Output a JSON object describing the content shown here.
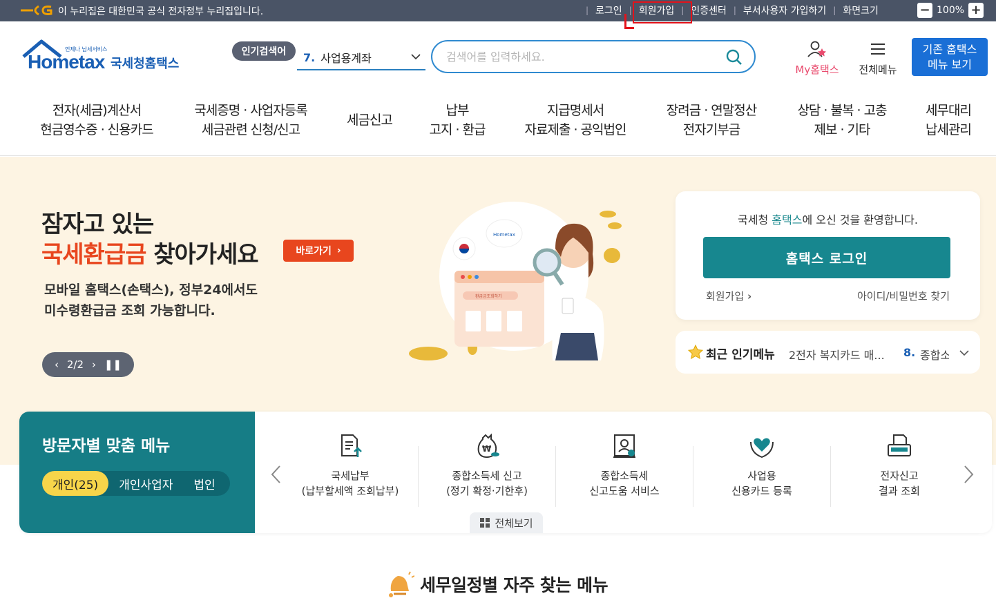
{
  "govbar": {
    "notice": "이 누리집은 대한민국 공식 전자정부 누리집입니다.",
    "links": [
      "로그인",
      "회원가입",
      "인증센터",
      "부서사용자 가입하기",
      "화면크기"
    ],
    "zoom": "100%",
    "zoom_minus": "−",
    "zoom_plus": "+"
  },
  "header": {
    "logo_brand": "Hometax",
    "logo_sub": "언제나 납세서비스",
    "logo_ko": "국세청홈택스",
    "popular_label": "인기검색어",
    "popular_num": "7.",
    "popular_term": "사업용계좌",
    "search_placeholder": "검색어를 입력하세요.",
    "my_label": "My홈택스",
    "all_menu_label": "전체메뉴",
    "old_menu_line1": "기존 홈택스",
    "old_menu_line2": "메뉴 보기"
  },
  "nav": [
    {
      "l1": "전자(세금)계산서",
      "l2": "현금영수증 · 신용카드"
    },
    {
      "l1": "국세증명 · 사업자등록",
      "l2": "세금관련 신청/신고"
    },
    {
      "l1": "세금신고",
      "l2": ""
    },
    {
      "l1": "납부",
      "l2": "고지 · 환급"
    },
    {
      "l1": "지급명세서",
      "l2": "자료제출 · 공익법인"
    },
    {
      "l1": "장려금 · 연말정산",
      "l2": "전자기부금"
    },
    {
      "l1": "상담 · 불복 · 고충",
      "l2": "제보 · 기타"
    },
    {
      "l1": "세무대리",
      "l2": "납세관리"
    }
  ],
  "hero": {
    "title1": "잠자고 있는",
    "title2_highlight": "국세환급금",
    "title2_rest": " 찾아가세요",
    "goto_label": "바로가기",
    "desc1": "모바일 홈택스(손택스), 정부24에서도",
    "desc2": "미수령환급금 조회 가능합니다.",
    "pager": "2/2",
    "illus_window_text": "환급금조회하기",
    "illus_bubble": "Hometax"
  },
  "login": {
    "welcome_pre": "국세청 ",
    "welcome_brand": "홈택스",
    "welcome_post": "에 오신 것을 환영합니다.",
    "button": "홈택스 로그인",
    "join": "회원가입",
    "find": "아이디/비밀번호 찾기"
  },
  "recent": {
    "label": "최근 인기메뉴",
    "item1": "2전자 복지카드 매...",
    "num2": "8.",
    "item2": "종합소득세"
  },
  "visitor": {
    "title": "방문자별 맞춤 메뉴",
    "tabs": [
      "개인(25)",
      "개인사업자",
      "법인"
    ],
    "items": [
      {
        "l1": "국세납부",
        "l2": "(납부할세액 조회납부)"
      },
      {
        "l1": "종합소득세 신고",
        "l2": "(정기 확정·기한후)"
      },
      {
        "l1": "종합소득세",
        "l2": "신고도움 서비스"
      },
      {
        "l1": "사업용",
        "l2": "신용카드 등록"
      },
      {
        "l1": "전자신고",
        "l2": "결과 조회"
      }
    ],
    "view_all": "전체보기"
  },
  "schedule": {
    "title": "세무일정별 자주 찾는 메뉴"
  },
  "colors": {
    "govbar": "#4a5466",
    "teal": "#167d86",
    "login_btn": "#17878f",
    "accent_orange": "#e8461e",
    "brand_blue": "#1a5fb4",
    "hero_bg": "#fdf4e3",
    "pill_yellow": "#f7d54a"
  }
}
